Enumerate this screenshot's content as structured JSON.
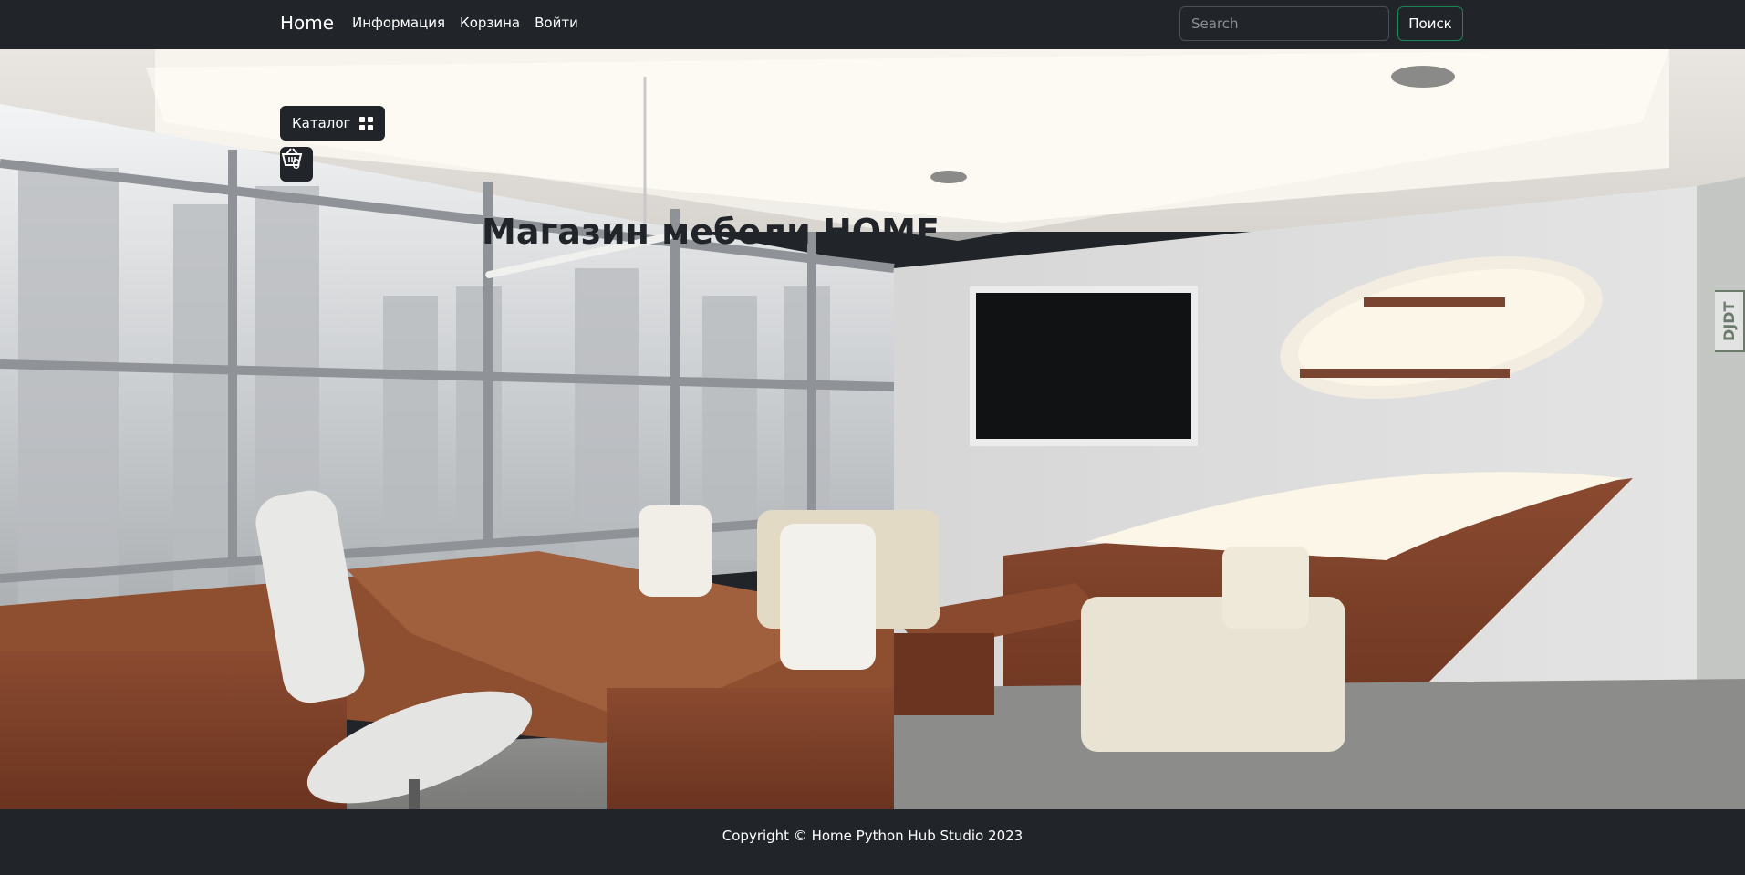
{
  "navbar": {
    "brand": "Home",
    "links": [
      "Информация",
      "Корзина",
      "Войти"
    ],
    "search": {
      "placeholder": "Search",
      "value": ""
    },
    "search_button": "Поиск"
  },
  "hero": {
    "catalog_button": "Каталог",
    "cart_count": "0",
    "title": "Магазин мебели HOME",
    "watermark": "DJDT"
  },
  "footer": {
    "copyright": "Copyright © Home Python Hub Studio 2023"
  },
  "icons": {
    "catalog": "grid-icon",
    "cart": "basket-icon"
  },
  "colors": {
    "navbar_bg": "#212529",
    "search_button_border": "#198754",
    "text_light": "#ffffff",
    "title_text": "#212529"
  }
}
